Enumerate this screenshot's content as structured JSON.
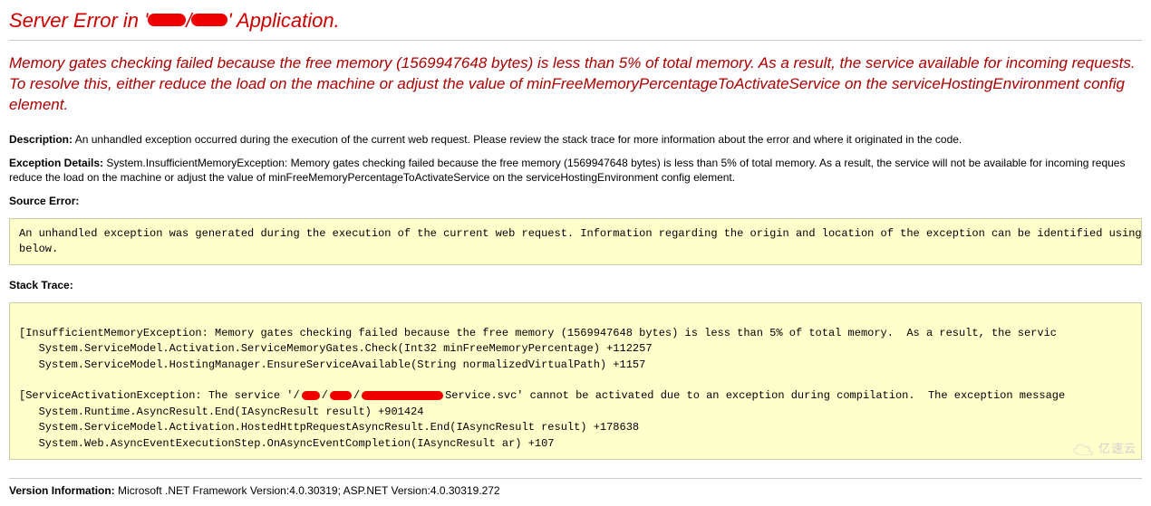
{
  "title": {
    "prefix": "Server Error in '",
    "suffix": "' Application."
  },
  "main_message": "Memory gates checking failed because the free memory (1569947648 bytes) is less than 5% of total memory.  As a result, the service available for incoming requests.  To resolve this, either reduce the load on the machine or adjust the value of minFreeMemoryPercentageToActivateService on the serviceHostingEnvironment config element.",
  "description": {
    "label": "Description:",
    "text": "An unhandled exception occurred during the execution of the current web request. Please review the stack trace for more information about the error and where it originated in the code."
  },
  "exception_details": {
    "label": "Exception Details:",
    "text": "System.InsufficientMemoryException: Memory gates checking failed because the free memory (1569947648 bytes) is less than 5% of total memory.  As a result, the service will not be available for incoming reques reduce the load on the machine or adjust the value of minFreeMemoryPercentageToActivateService on the serviceHostingEnvironment config element."
  },
  "source_error": {
    "label": "Source Error:",
    "box": "An unhandled exception was generated during the execution of the current web request. Information regarding the origin and location of the exception can be identified using the excep\nbelow."
  },
  "stack_trace": {
    "label": "Stack Trace:",
    "box_pre": "\n[InsufficientMemoryException: Memory gates checking failed because the free memory (1569947648 bytes) is less than 5% of total memory.  As a result, the servic\n   System.ServiceModel.Activation.ServiceMemoryGates.Check(Int32 minFreeMemoryPercentage) +112257\n   System.ServiceModel.HostingManager.EnsureServiceAvailable(String normalizedVirtualPath) +1157\n\n[ServiceActivationException: The service '/",
    "box_post": "Service.svc' cannot be activated due to an exception during compilation.  The exception message \n   System.Runtime.AsyncResult.End(IAsyncResult result) +901424\n   System.ServiceModel.Activation.HostedHttpRequestAsyncResult.End(IAsyncResult result) +178638\n   System.Web.AsyncEventExecutionStep.OnAsyncEventCompletion(IAsyncResult ar) +107\n"
  },
  "version_info": {
    "label": "Version Information:",
    "text": "Microsoft .NET Framework Version:4.0.30319; ASP.NET Version:4.0.30319.272"
  },
  "watermark": "亿速云"
}
